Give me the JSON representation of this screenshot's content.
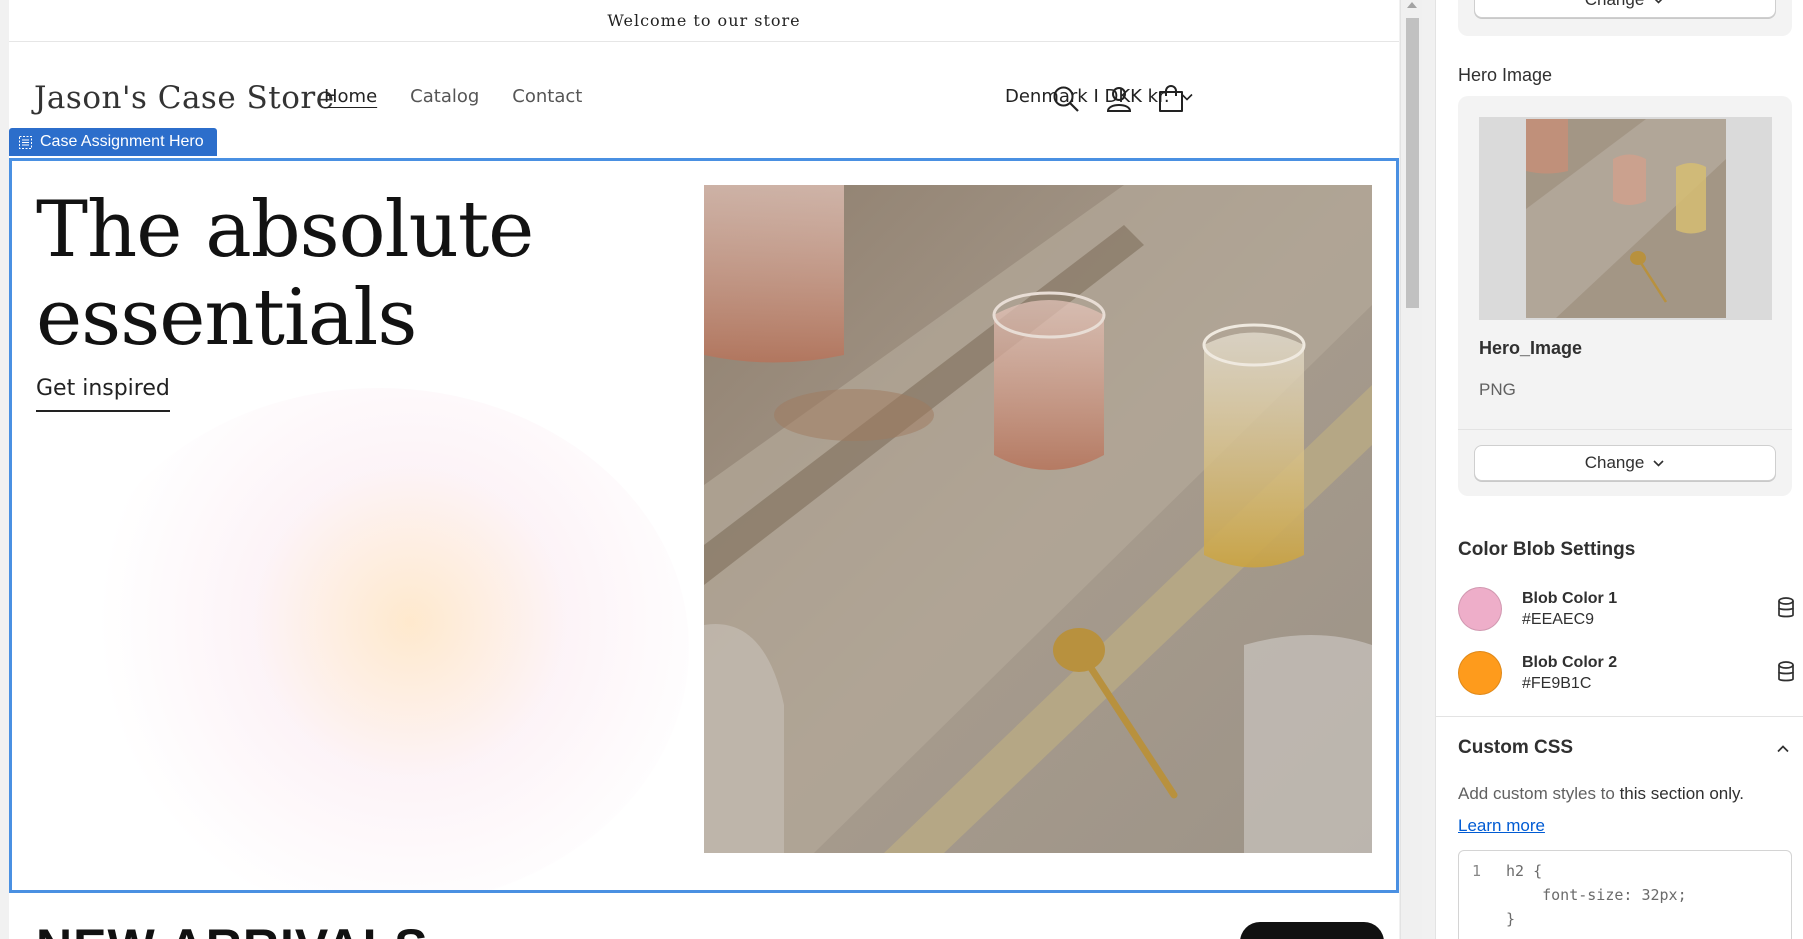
{
  "announcement": "Welcome to our store",
  "store": {
    "logo": "Jason's Case Store",
    "nav": [
      "Home",
      "Catalog",
      "Contact"
    ],
    "country": "Denmark I DKK kr.",
    "icons": [
      "search-icon",
      "account-icon",
      "cart-icon"
    ]
  },
  "section_tag": "Case Assignment Hero",
  "hero": {
    "title": "The absolute essentials",
    "link": "Get inspired"
  },
  "next_section": {
    "heading": "NEW ARRIVALS"
  },
  "sidebar": {
    "top_change": "Change",
    "hero_image_label": "Hero Image",
    "image_name": "Hero_Image",
    "image_type": "PNG",
    "change": "Change",
    "blob_heading": "Color Blob Settings",
    "blobs": [
      {
        "name": "Blob Color 1",
        "hex": "#EEAEC9",
        "color": "#EEAEC9"
      },
      {
        "name": "Blob Color 2",
        "hex": "#FE9B1C",
        "color": "#FE9B1C"
      }
    ],
    "css_heading": "Custom CSS",
    "css_desc_pre": "Add custom styles to ",
    "css_desc_bold": "this section only.",
    "learn_more": "Learn more",
    "code": {
      "num1": "1",
      "line1": "h2 {",
      "line2": "    font-size: 32px;",
      "line3": "}"
    }
  },
  "colors": {
    "accent": "#2c6ecb",
    "frame": "#4a90e2",
    "link": "#005bd3"
  }
}
